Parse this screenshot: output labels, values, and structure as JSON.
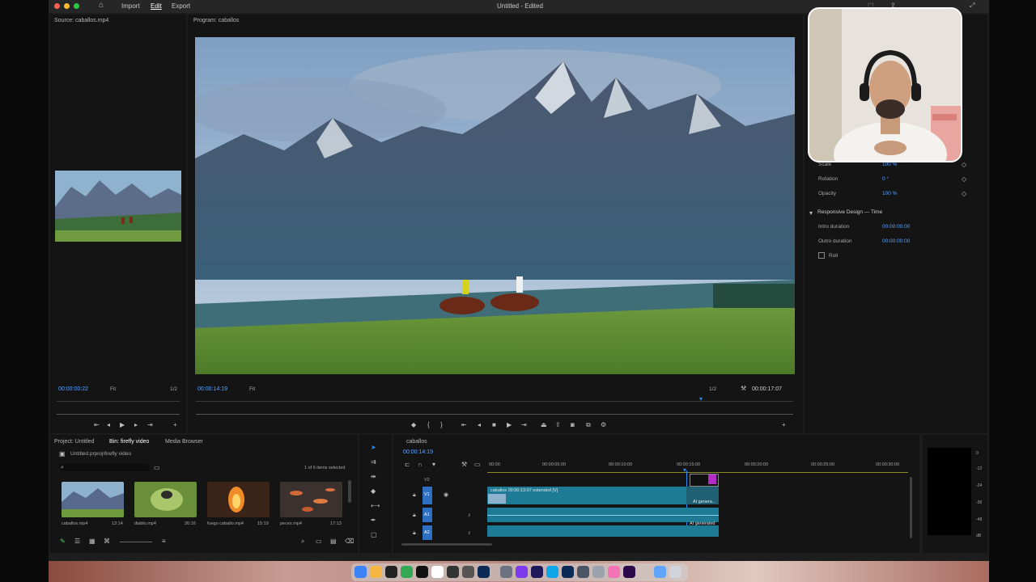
{
  "titlebar": {
    "title": "Untitled - Edited",
    "menus": [
      "Import",
      "Edit",
      "Export"
    ],
    "active_menu": "Edit"
  },
  "source_panel": {
    "title": "Source: caballos.mp4",
    "timecode": "00:00:00:22",
    "fit": "Fit",
    "ratio": "1/2"
  },
  "program_panel": {
    "title": "Program: caballos",
    "timecode": "00:00:14:19",
    "fit": "Fit",
    "ratio": "1/2",
    "duration": "00:00:17:07"
  },
  "effect_controls": {
    "rows": [
      {
        "label": "Scale",
        "value": "100 %"
      },
      {
        "label": "Rotation",
        "value": "0 °"
      },
      {
        "label": "Opacity",
        "value": "100 %"
      }
    ],
    "section": "Responsive Design — Time",
    "time_rows": [
      {
        "label": "Intro duration",
        "value": "00:00:00:00"
      },
      {
        "label": "Outro duration",
        "value": "00:00:00:00"
      }
    ],
    "checkbox_label": "Roll"
  },
  "project_panel": {
    "tabs": [
      "Project: Untitled",
      "Bin: firefly video",
      "Media Browser"
    ],
    "active_tab": "Bin: firefly video",
    "path": "Untitled.prproj\\firefly video",
    "count": "1 of 6 items selected",
    "items": [
      {
        "name": "caballos.mp4",
        "duration": "13:14"
      },
      {
        "name": "diablo.mp4",
        "duration": "26:16"
      },
      {
        "name": "fuego caballo.mp4",
        "duration": "15:19"
      },
      {
        "name": "peces.mp4",
        "duration": "17:13"
      }
    ]
  },
  "timeline": {
    "sequence": "caballos",
    "timecode": "00:00:14:19",
    "ruler": [
      "00:00",
      "00:00:05:00",
      "00:00:10:00",
      "00:00:15:00",
      "00:00:20:00",
      "00:00:25:00",
      "00:00:30:00"
    ],
    "tracks": [
      "V2",
      "V1",
      "A1",
      "A2"
    ],
    "clip_v1": "caballos 00:00:13:07 extended [V]",
    "ai_label_v": "AI genera...",
    "ai_label_a": "AI generated"
  },
  "meter": {
    "scale": [
      "0",
      "-12",
      "-24",
      "-36",
      "-48",
      "dB"
    ]
  },
  "colors": {
    "accent": "#2d8cf0",
    "clip": "#1e7b95",
    "ai_clip": "#b42bc7"
  }
}
